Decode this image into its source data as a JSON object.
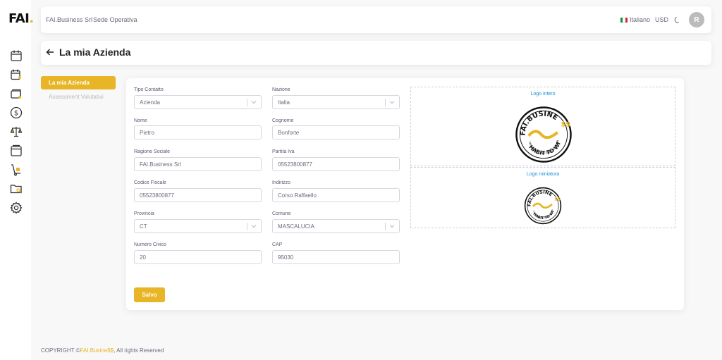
{
  "app": {
    "logo_text": "FAI",
    "logo_dot": ".",
    "brand_color": "#e8b526",
    "sidebar_icons": [
      "calendar-icon",
      "calendar-person-icon",
      "cards-icon",
      "dollar-icon",
      "scale-icon",
      "window-icon",
      "hand-truck-icon",
      "folder-search-icon",
      "gear-icon"
    ]
  },
  "navbar": {
    "company": "FAI.Business Srl",
    "location": "Sede Operativa",
    "language": "Italiano",
    "currency": "USD",
    "avatar_initial": "R"
  },
  "page": {
    "title": "La mia Azienda"
  },
  "tabs": {
    "active": "La mia Azienda",
    "inactive": "Assessment Valutativi"
  },
  "form": {
    "tipo_contatto": {
      "label": "Tipo Contatto",
      "value": "Azienda"
    },
    "nazione": {
      "label": "Nazione",
      "value": "Italia"
    },
    "nome": {
      "label": "Nome",
      "value": "Pietro"
    },
    "cognome": {
      "label": "Cognome",
      "value": "Bonforte"
    },
    "ragione_sociale": {
      "label": "Ragione Sociale",
      "value": "FAI.Business Srl"
    },
    "partita_iva": {
      "label": "Partita Iva",
      "value": "05523800877"
    },
    "codice_fiscale": {
      "label": "Codice Fiscale",
      "value": "05523800877"
    },
    "indirizzo": {
      "label": "Indirizzo",
      "value": "Corso Raffaello"
    },
    "provincia": {
      "label": "Provincia",
      "value": "CT"
    },
    "comune": {
      "label": "Comune",
      "value": "MASCALUCIA"
    },
    "numero_civico": {
      "label": "Numero Civico",
      "value": "20"
    },
    "cap": {
      "label": "CAP",
      "value": "95030"
    },
    "save_label": "Salvo"
  },
  "logos": {
    "full_caption": "Logo intero",
    "mini_caption": "Logo miniatura",
    "badge_top": "FAI.BUSINE",
    "badge_dollars": "$$",
    "badge_mid": "MARKETING AND ORGANIZATION",
    "badge_bottom": "HABIT TO WIN"
  },
  "footer": {
    "prefix": "COPYRIGHT ©",
    "brand": "FAI.Busine$$",
    "suffix": ", All rights Reserved"
  }
}
